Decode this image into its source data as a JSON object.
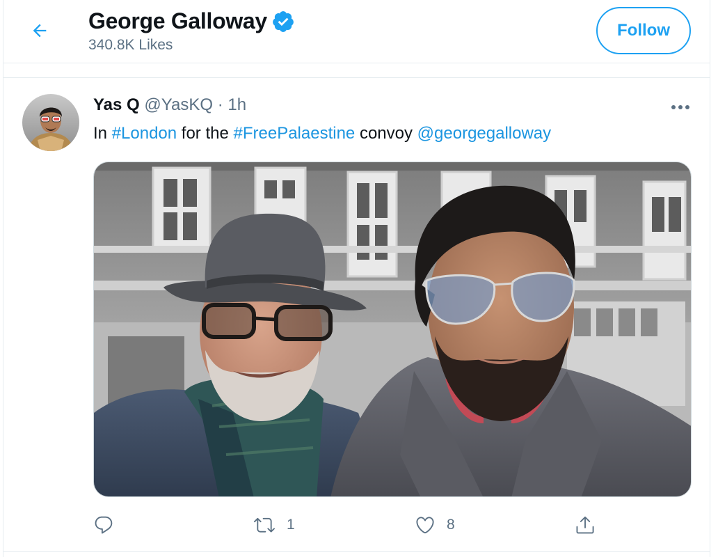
{
  "header": {
    "title": "George Galloway",
    "subtitle": "340.8K Likes",
    "follow_label": "Follow"
  },
  "tweet": {
    "author_name": "Yas Q",
    "author_handle": "@YasKQ",
    "separator": "·",
    "time": "1h",
    "text_parts": {
      "t1": "In ",
      "l1": "#London",
      "t2": " for the ",
      "l2": "#FreePalaestine",
      "t3": " convoy ",
      "l3": "@georgegalloway"
    },
    "actions": {
      "reply_count": "",
      "retweet_count": "1",
      "like_count": "8",
      "share_count": ""
    }
  },
  "icons": {
    "back": "arrow-left-icon",
    "verified": "verified-badge-icon",
    "more": "more-horizontal-icon",
    "reply": "reply-icon",
    "retweet": "retweet-icon",
    "like": "heart-icon",
    "share": "share-icon"
  },
  "colors": {
    "accent": "#1da1f2",
    "link": "#1b95e0",
    "muted": "#5b7083",
    "text": "#0f1419"
  }
}
